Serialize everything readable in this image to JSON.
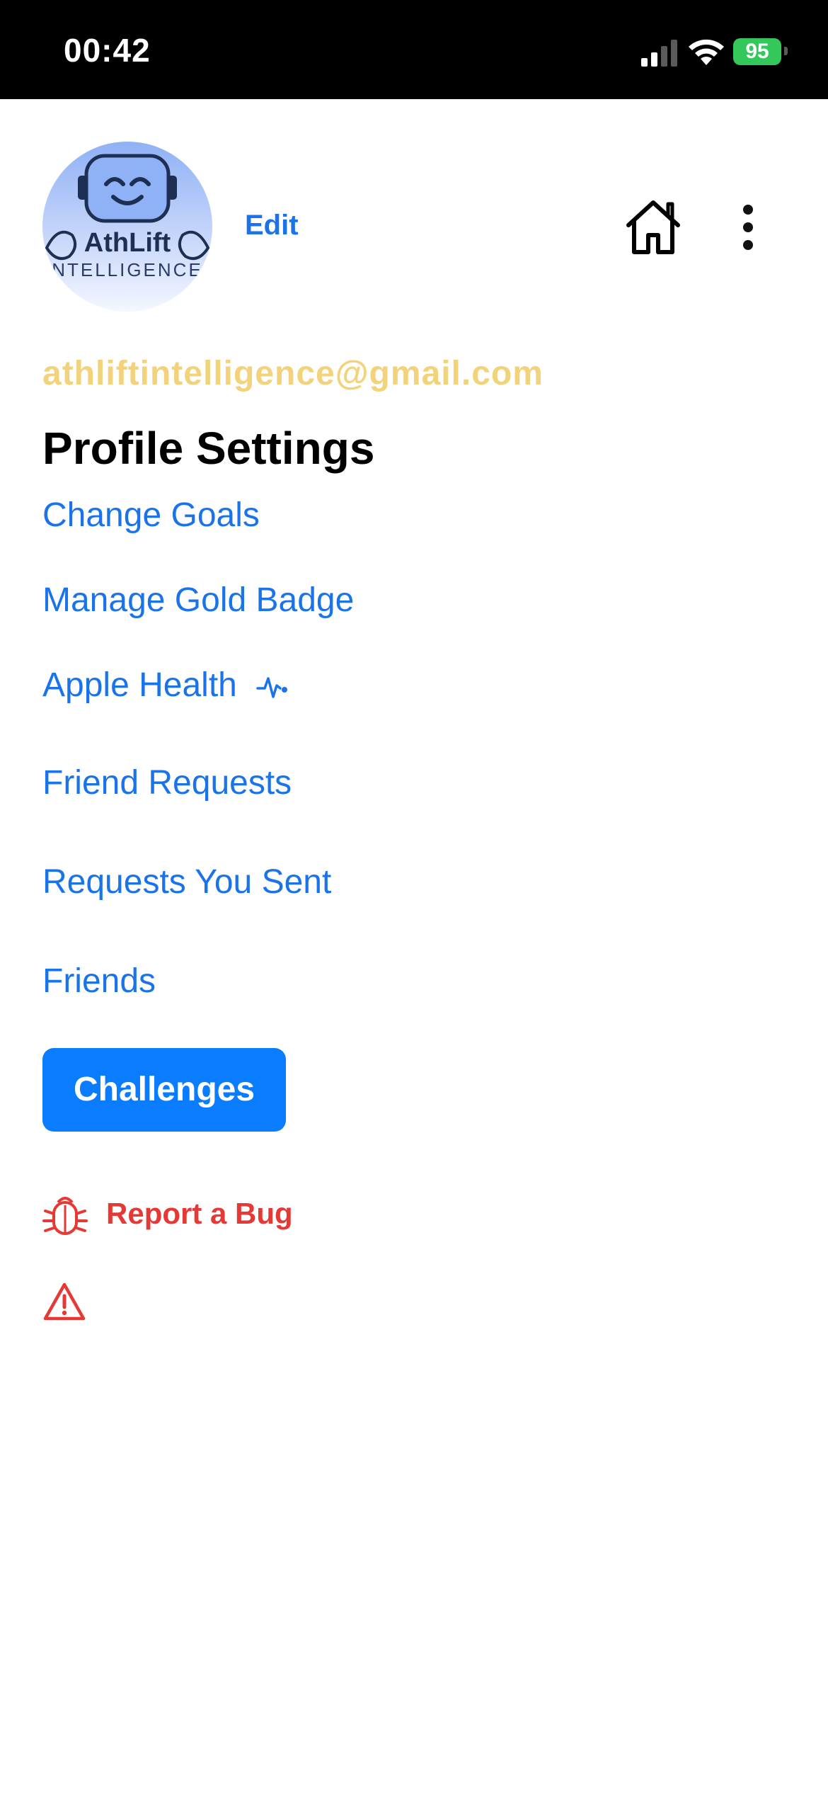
{
  "status_bar": {
    "time": "00:42",
    "battery_level": "95",
    "battery_color": "#34c759"
  },
  "profile": {
    "avatar_text_line1": "AthLift",
    "avatar_text_line2": "NTELLIGENCE",
    "edit_label": "Edit",
    "email": "athliftintelligence@gmail.com"
  },
  "header_icons": [
    "home-icon",
    "more-vertical-icon"
  ],
  "settings": {
    "title": "Profile Settings",
    "items": [
      {
        "label": "Change Goals"
      },
      {
        "label": "Manage Gold Badge"
      },
      {
        "label": "Apple Health",
        "icon": "heart-pulse-icon"
      },
      {
        "label": "Friend Requests"
      },
      {
        "label": "Requests You Sent"
      },
      {
        "label": "Friends"
      }
    ],
    "challenges_label": "Challenges",
    "report_bug_label": "Report a Bug",
    "report_bug_icon": "bug-icon",
    "warning_icon": "warning-icon"
  },
  "colors": {
    "link_blue": "#1a73e8",
    "button_blue": "#0a7cff",
    "email_gold": "#f2d37c",
    "danger_red": "#e53935"
  }
}
